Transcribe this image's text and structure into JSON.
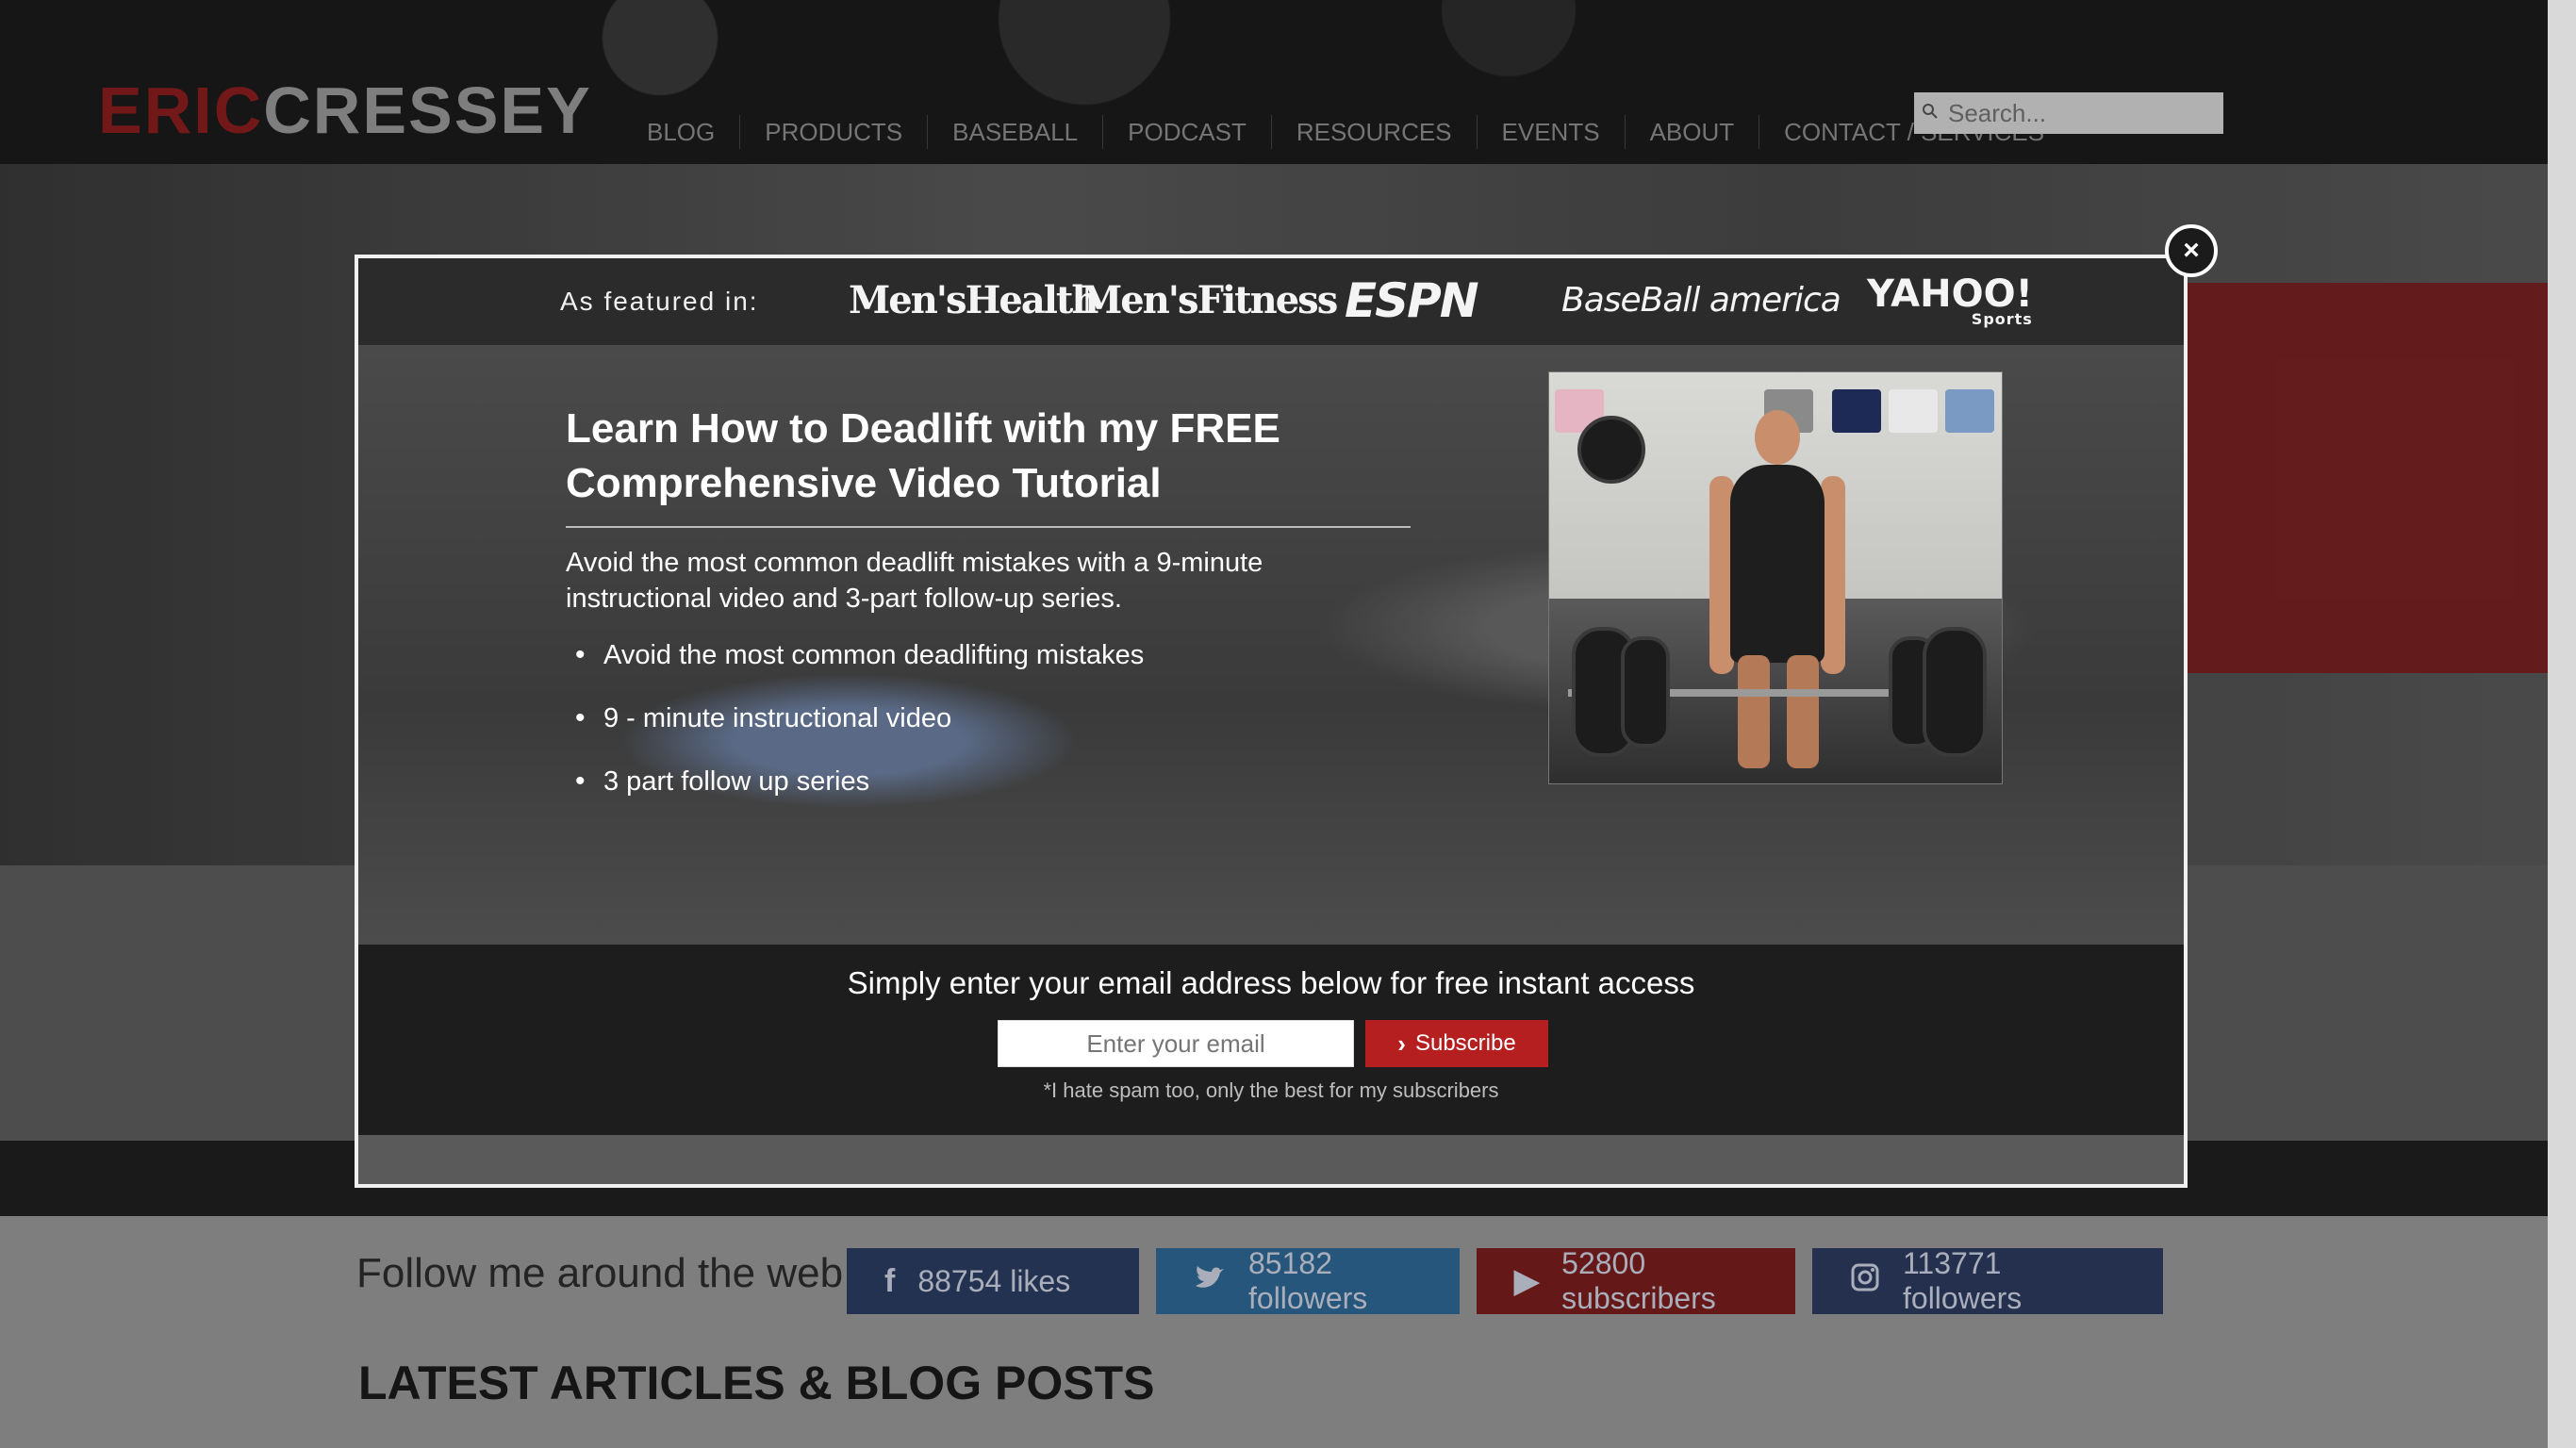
{
  "header": {
    "logo_part1": "ERIC",
    "logo_part2": "CRESSEY",
    "nav": [
      "BLOG",
      "PRODUCTS",
      "BASEBALL",
      "PODCAST",
      "RESOURCES",
      "EVENTS",
      "ABOUT",
      "CONTACT / SERVICES"
    ],
    "search_placeholder": "Search...",
    "search_icon": "search-icon"
  },
  "modal": {
    "featured_label": "As featured in:",
    "brands": {
      "mens_health": "Men'sHealth",
      "mens_fitness": "Men'sFitness",
      "espn": "ESPN",
      "baseball_america": "BaseBall america",
      "yahoo": "YAHOO!",
      "yahoo_sub": "Sports"
    },
    "headline": "Learn How to Deadlift with my FREE Comprehensive Video Tutorial",
    "intro": "Avoid the most common deadlift mistakes with a 9-minute instructional video and 3-part follow-up series.",
    "bullets": [
      "Avoid the most common deadlifting mistakes",
      "9 - minute instructional video",
      "3 part follow up series"
    ],
    "signup_title": "Simply enter your email address below for free instant access",
    "email_placeholder": "Enter your email",
    "subscribe_label": "Subscribe",
    "spam_note": "*I hate spam too, only the best for my subscribers",
    "close_symbol": "×"
  },
  "follow": {
    "title": "Follow me around the web",
    "facebook": "88754 likes",
    "twitter": "85182 followers",
    "youtube": "52800 subscribers",
    "instagram": "113771 followers"
  },
  "latest_title": "LATEST ARTICLES & BLOG POSTS",
  "colors": {
    "accent_red": "#b51f1f",
    "facebook": "#2d3d63",
    "twitter": "#2f6a96",
    "youtube": "#7a1e1e",
    "instagram": "#2c3b60"
  }
}
